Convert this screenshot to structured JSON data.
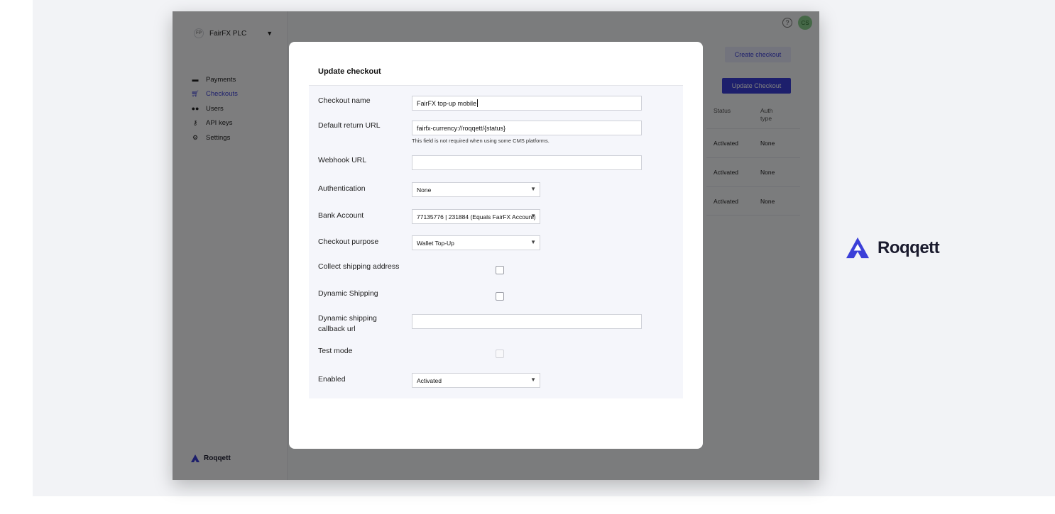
{
  "sidebar": {
    "org_badge": "FP",
    "org_name": "FairFX PLC",
    "items": [
      {
        "label": "Payments",
        "icon": "payments-icon",
        "active": false
      },
      {
        "label": "Checkouts",
        "icon": "cart-icon",
        "active": true
      },
      {
        "label": "Users",
        "icon": "users-icon",
        "active": false
      },
      {
        "label": "API keys",
        "icon": "key-icon",
        "active": false
      },
      {
        "label": "Settings",
        "icon": "gear-icon",
        "active": false
      }
    ],
    "brand": "Roqqett"
  },
  "header": {
    "help_glyph": "?",
    "avatar_initials": "CS"
  },
  "page": {
    "create_label": "Create checkout",
    "update_label": "Update Checkout",
    "table": {
      "headers": [
        "Status",
        "Auth type"
      ],
      "rows": [
        {
          "status": "Activated",
          "auth": "None"
        },
        {
          "status": "Activated",
          "auth": "None"
        },
        {
          "status": "Activated",
          "auth": "None"
        }
      ]
    }
  },
  "modal": {
    "title": "Update checkout",
    "fields": {
      "checkout_name": {
        "label": "Checkout name",
        "value": "FairFX  top-up mobile"
      },
      "return_url": {
        "label": "Default return URL",
        "value": "fairfx-currency://roqqett/{status}",
        "hint": "This field is not required when using some CMS platforms."
      },
      "webhook_url": {
        "label": "Webhook URL",
        "value": ""
      },
      "authentication": {
        "label": "Authentication",
        "value": "None"
      },
      "bank_account": {
        "label": "Bank Account",
        "value": "77135776 | 231884 (Equals FairFX Account)"
      },
      "purpose": {
        "label": "Checkout purpose",
        "value": "Wallet Top-Up"
      },
      "collect_shipping": {
        "label": "Collect shipping address",
        "checked": false
      },
      "dynamic_shipping": {
        "label": "Dynamic Shipping",
        "checked": false
      },
      "shipping_callback": {
        "label": "Dynamic shipping callback url",
        "value": ""
      },
      "test_mode": {
        "label": "Test mode",
        "checked": false
      },
      "enabled": {
        "label": "Enabled",
        "value": "Activated"
      }
    }
  },
  "brand_logo": {
    "name": "Roqqett",
    "color": "#3b3fd8"
  }
}
